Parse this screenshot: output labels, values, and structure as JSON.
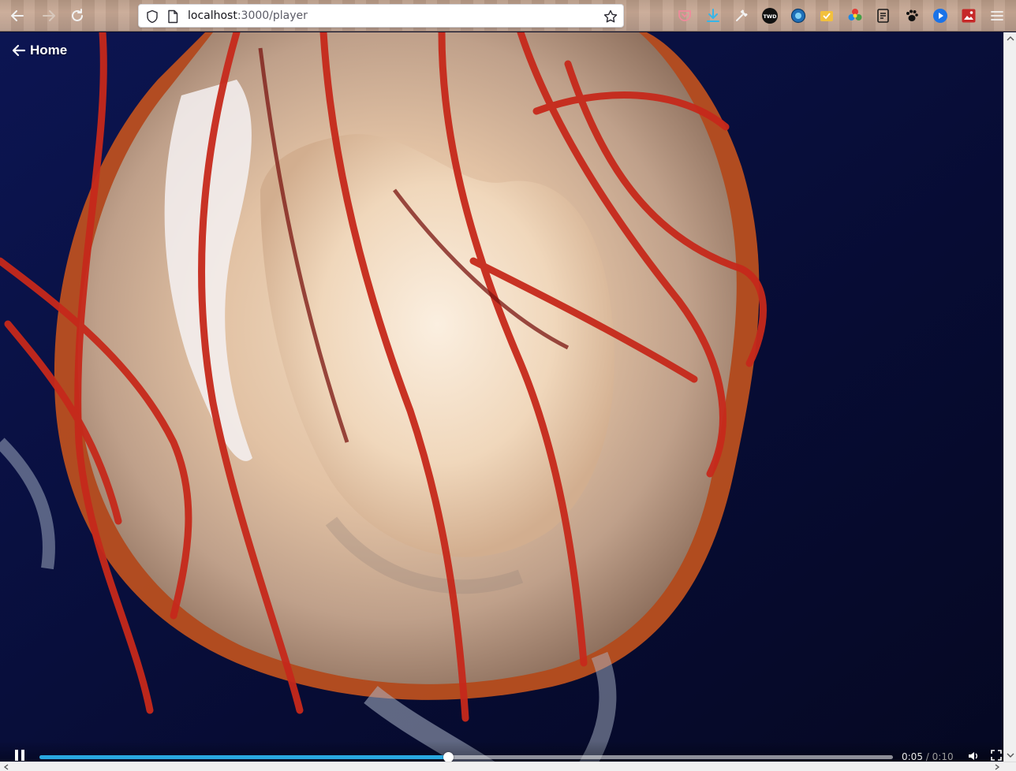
{
  "browser": {
    "url_host": "localhost",
    "url_rest": ":3000/player",
    "icons": {
      "back": "back-arrow-icon",
      "forward": "forward-arrow-icon",
      "reload": "reload-icon",
      "shield": "shield-icon",
      "page": "page-icon",
      "bookmark": "star-icon",
      "menu": "hamburger-menu-icon"
    },
    "extensions": [
      "pocket-icon",
      "download-icon",
      "wrench-icon",
      "twd-extension-icon",
      "globe-extension-icon",
      "folder-extension-icon",
      "color-wheel-icon",
      "notes-icon",
      "paw-icon",
      "play-extension-icon",
      "image-extension-icon"
    ],
    "extension_label_twd": "TWD"
  },
  "page": {
    "home_link": "Home",
    "video_subject": "jellyfish-video-frame"
  },
  "player": {
    "current_time": "0:05",
    "separator": "/",
    "duration": "0:10",
    "progress_fraction": 0.479,
    "state": "playing",
    "colors": {
      "progress": "#29a8e0",
      "track": "#c9ccd3"
    }
  }
}
